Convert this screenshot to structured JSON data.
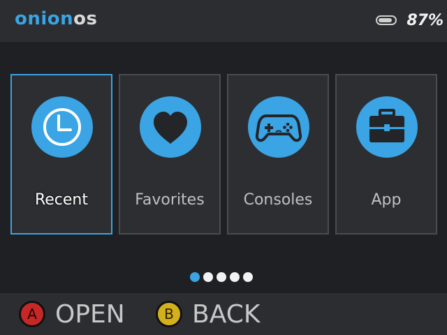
{
  "header": {
    "logo_part1": "onion",
    "logo_part2": "os",
    "battery_percent_text": "87%",
    "battery_level": 0.87
  },
  "menu": {
    "items": [
      {
        "label": "Recent",
        "icon": "clock-icon",
        "selected": true
      },
      {
        "label": "Favorites",
        "icon": "heart-icon",
        "selected": false
      },
      {
        "label": "Consoles",
        "icon": "gamepad-icon",
        "selected": false
      },
      {
        "label": "App",
        "icon": "toolbox-icon",
        "selected": false
      }
    ]
  },
  "pagination": {
    "total": 5,
    "current": 1
  },
  "footer": {
    "a_button": "A",
    "a_action": "OPEN",
    "b_button": "B",
    "b_action": "BACK"
  },
  "colors": {
    "accent": "#3aa4e4",
    "a_button": "#c62828",
    "b_button": "#d4b01a"
  }
}
